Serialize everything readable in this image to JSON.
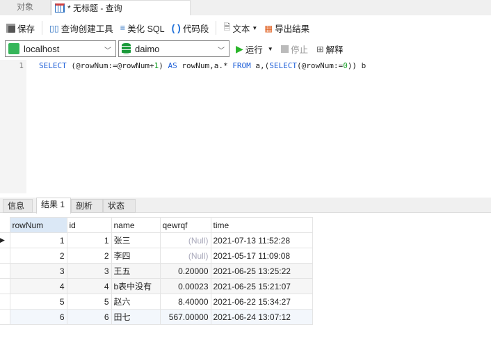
{
  "tabs": {
    "objects": "对象",
    "query": "* 无标题 - 查询"
  },
  "toolbar": {
    "save": "保存",
    "query_builder": "查询创建工具",
    "beautify": "美化 SQL",
    "snippet": "代码段",
    "text": "文本",
    "export": "导出结果"
  },
  "connection": {
    "host": "localhost",
    "database": "daimo",
    "run": "运行",
    "stop": "停止",
    "explain": "解释"
  },
  "editor": {
    "line": "1",
    "tokens": [
      {
        "t": "SELECT",
        "c": "kw"
      },
      {
        "t": " (@rowNum:=@rowNum+",
        "c": "tx"
      },
      {
        "t": "1",
        "c": "num"
      },
      {
        "t": ") ",
        "c": "tx"
      },
      {
        "t": "AS",
        "c": "kw"
      },
      {
        "t": " rowNum,a.* ",
        "c": "tx"
      },
      {
        "t": "FROM",
        "c": "kw"
      },
      {
        "t": " a,(",
        "c": "tx"
      },
      {
        "t": "SELECT",
        "c": "kw"
      },
      {
        "t": "(@rowNum:=",
        "c": "tx"
      },
      {
        "t": "0",
        "c": "num"
      },
      {
        "t": ")) b",
        "c": "tx"
      }
    ]
  },
  "result_tabs": [
    "信息",
    "结果 1",
    "剖析",
    "状态"
  ],
  "grid": {
    "columns": [
      "rowNum",
      "id",
      "name",
      "qewrqf",
      "time"
    ],
    "rows": [
      [
        "1",
        "1",
        "张三",
        "(Null)",
        "2021-07-13 11:52:28"
      ],
      [
        "2",
        "2",
        "李四",
        "(Null)",
        "2021-05-17 11:09:08"
      ],
      [
        "3",
        "3",
        "王五",
        "0.20000",
        "2021-06-25 13:25:22"
      ],
      [
        "4",
        "4",
        "b表中没有",
        "0.00023",
        "2021-06-25 15:21:07"
      ],
      [
        "5",
        "5",
        "赵六",
        "8.40000",
        "2021-06-22 15:34:27"
      ],
      [
        "6",
        "6",
        "田七",
        "567.00000",
        "2021-06-24 13:07:12"
      ]
    ]
  }
}
